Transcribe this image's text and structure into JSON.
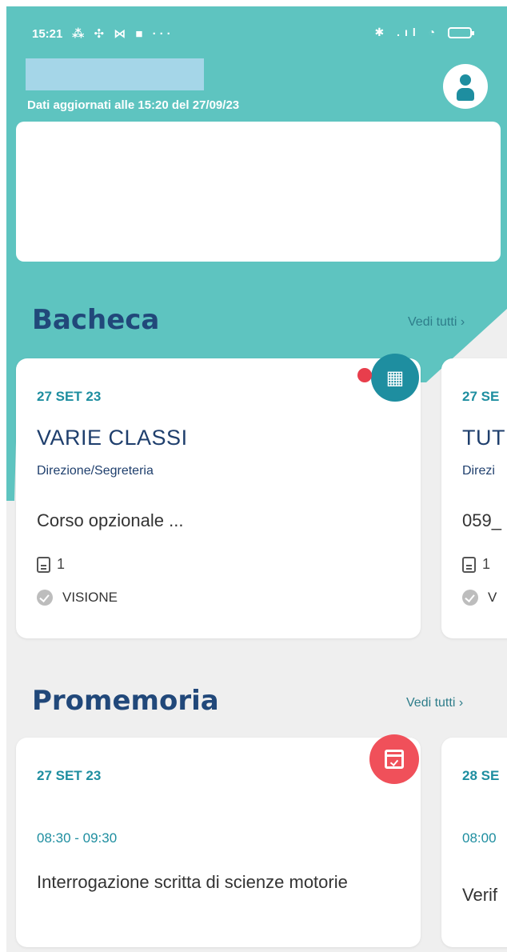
{
  "status_bar": {
    "time": "15:21",
    "left_icons": "⁂ ✣ ⋈ ■ ···",
    "right_icons": "✱ .ıl ◔"
  },
  "header": {
    "updated_text": "Dati aggiornati alle 15:20 del 27/09/23"
  },
  "bacheca": {
    "title": "Bacheca",
    "see_all": "Vedi tutti ›",
    "cards": [
      {
        "date": "27 SET 23",
        "title": "VARIE CLASSI",
        "sender": "Direzione/Segreteria",
        "text": "Corso opzionale ...",
        "attachments": "1",
        "status": "VISIONE"
      },
      {
        "date": "27 SE",
        "title": "TUT",
        "sender": "Direzi",
        "text": "059_",
        "attachments": "1",
        "status": "V"
      }
    ]
  },
  "promemoria": {
    "title": "Promemoria",
    "see_all": "Vedi tutti ›",
    "cards": [
      {
        "date": "27 SET 23",
        "time": "08:30 - 09:30",
        "text": "Interrogazione scritta di scienze motorie"
      },
      {
        "date": "28 SE",
        "time": "08:00",
        "text": "Verif"
      }
    ]
  },
  "colors": {
    "teal": "#5ec4c0",
    "dark_teal": "#1e8ea0",
    "navy": "#21487a",
    "red": "#f0505a"
  }
}
